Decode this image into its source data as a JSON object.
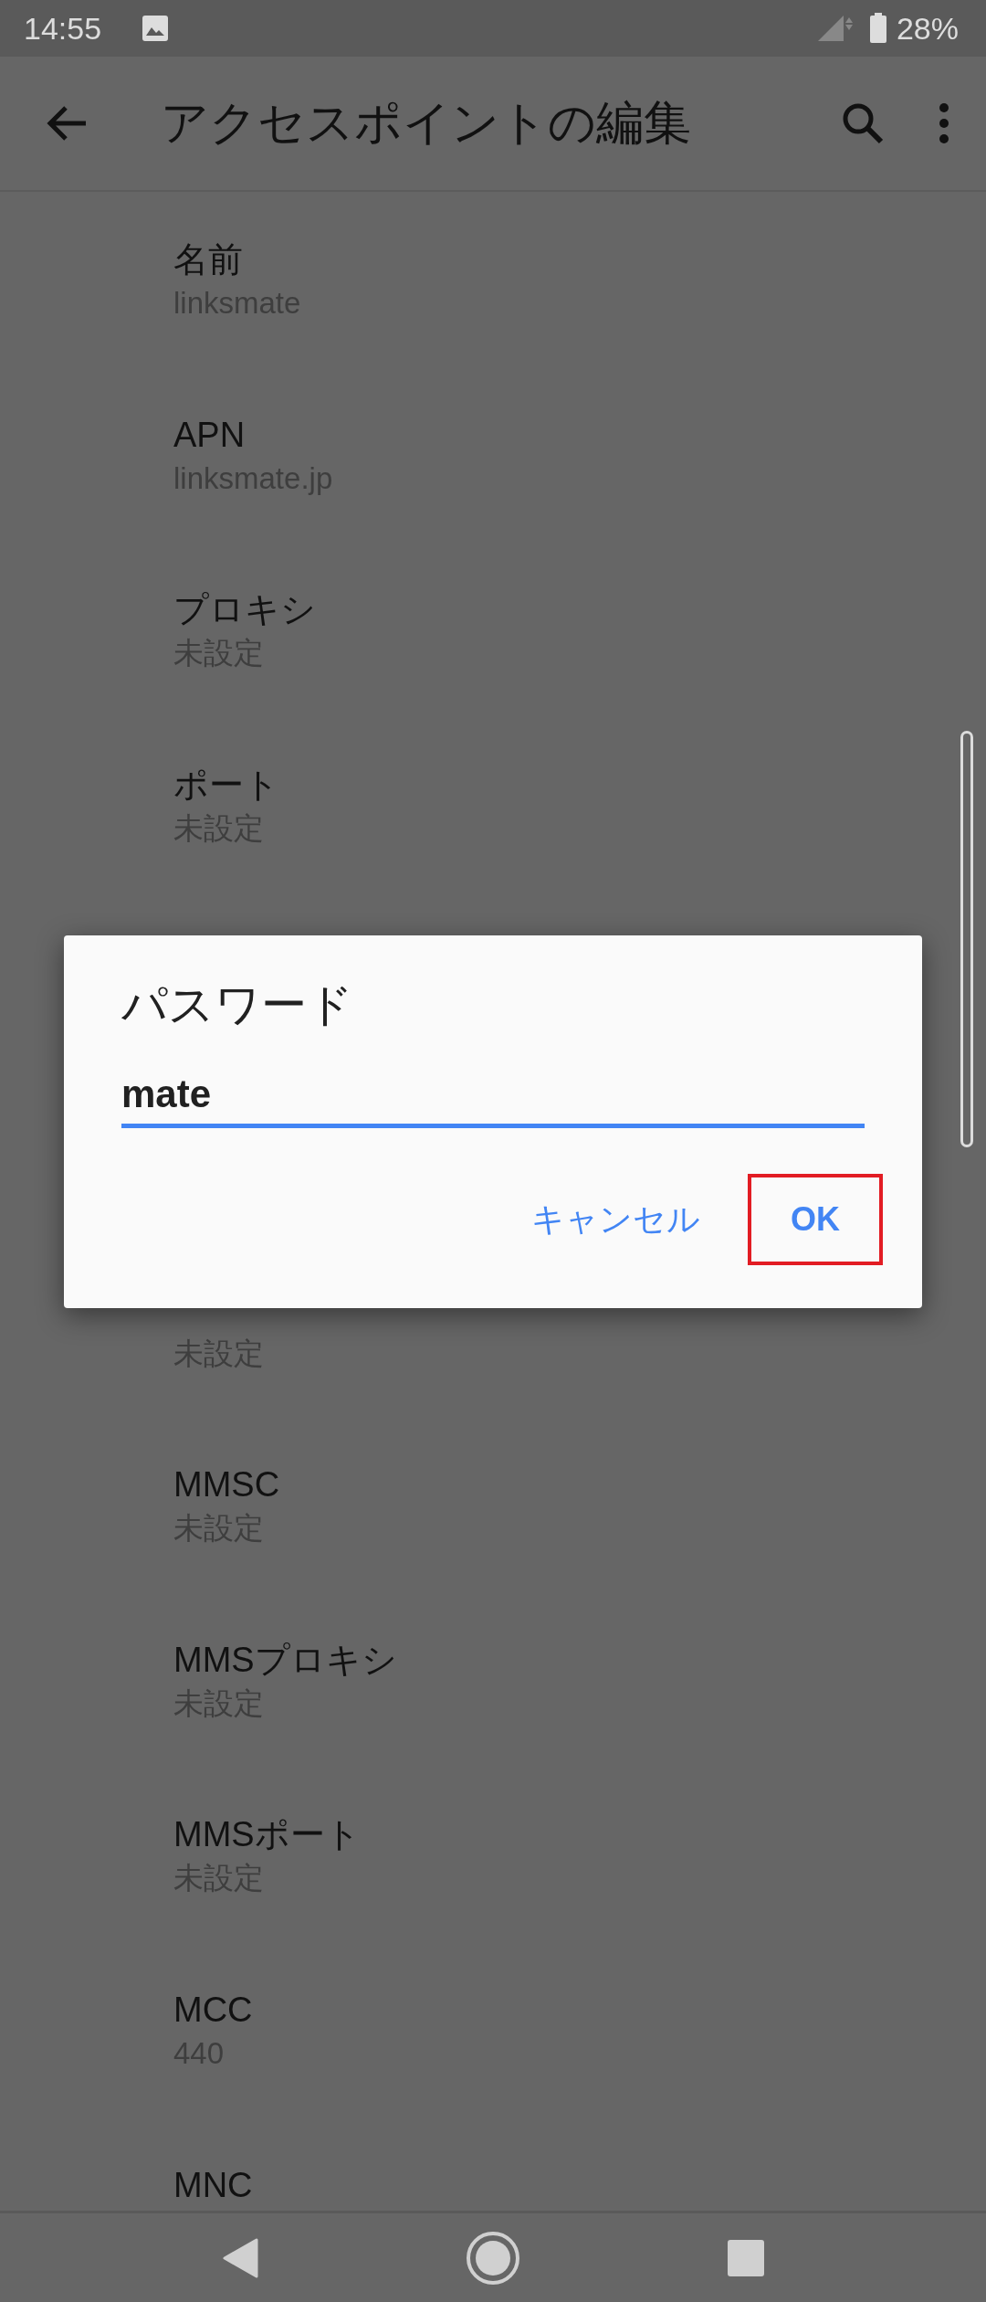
{
  "status_bar": {
    "time": "14:55",
    "battery": "28%"
  },
  "app_bar": {
    "title": "アクセスポイントの編集"
  },
  "settings": [
    {
      "title": "名前",
      "summary": "linksmate"
    },
    {
      "title": "APN",
      "summary": "linksmate.jp"
    },
    {
      "title": "プロキシ",
      "summary": "未設定"
    },
    {
      "title": "ポート",
      "summary": "未設定"
    }
  ],
  "settings_below_dialog": [
    {
      "summary": "未設定"
    },
    {
      "title": "MMSC",
      "summary": "未設定"
    },
    {
      "title": "MMSプロキシ",
      "summary": "未設定"
    },
    {
      "title": "MMSポート",
      "summary": "未設定"
    },
    {
      "title": "MCC",
      "summary": "440"
    },
    {
      "title": "MNC"
    }
  ],
  "dialog": {
    "title": "パスワード",
    "value": "mate",
    "buttons": [
      {
        "label": "キャンセル",
        "highlighted": false
      },
      {
        "label": "OK",
        "highlighted": true
      }
    ]
  }
}
